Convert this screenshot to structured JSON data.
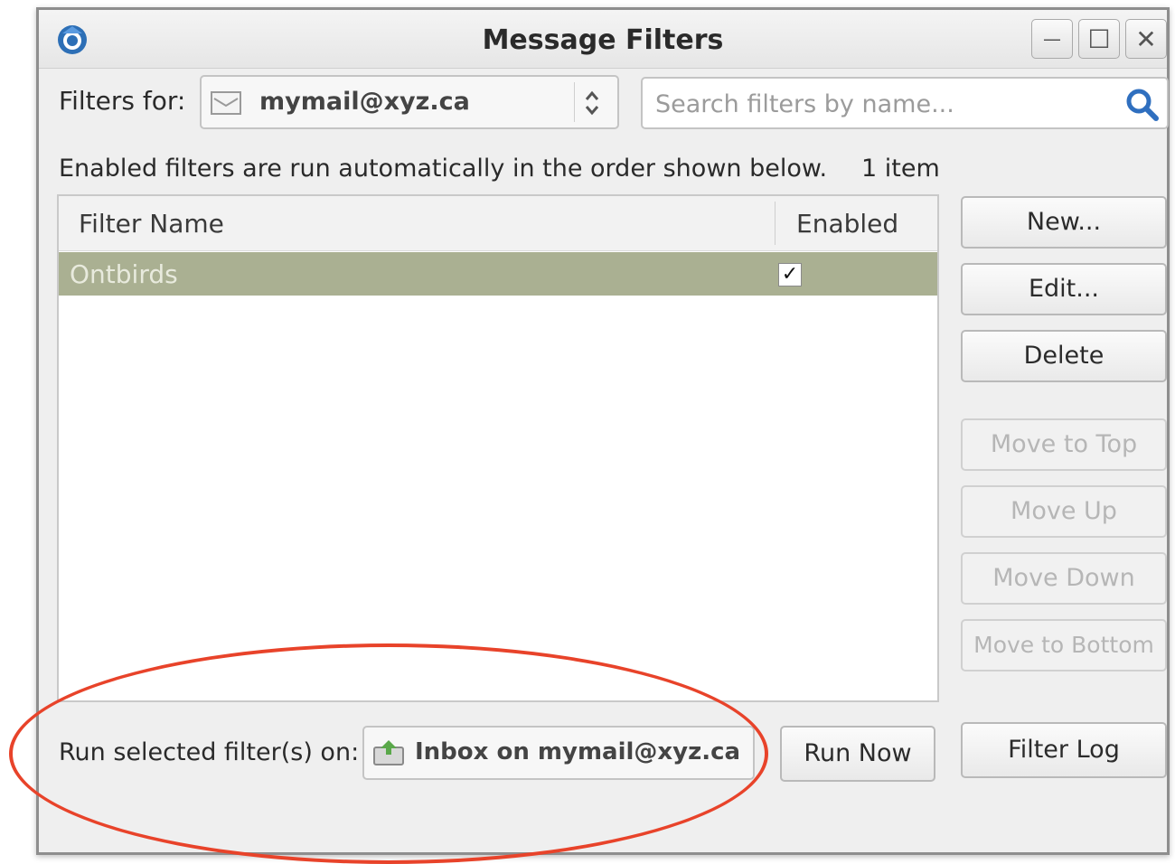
{
  "window": {
    "title": "Message Filters",
    "app_icon": "thunderbird-icon",
    "controls": {
      "minimize": "—",
      "maximize": "☐",
      "close": "✕"
    }
  },
  "filters_for": {
    "label": "Filters for:",
    "account": "mymail@xyz.ca"
  },
  "search": {
    "placeholder": "Search filters by name...",
    "value": ""
  },
  "info": {
    "description": "Enabled filters are run automatically in the order shown below.",
    "count": "1 item"
  },
  "list": {
    "columns": [
      "Filter Name",
      "Enabled"
    ],
    "rows": [
      {
        "name": "Ontbirds",
        "enabled": true,
        "selected": true
      }
    ]
  },
  "buttons": {
    "new": "New...",
    "edit": "Edit...",
    "delete": "Delete",
    "move_top": "Move to Top",
    "move_up": "Move Up",
    "move_down": "Move Down",
    "move_bottom": "Move to Bottom",
    "filter_log": "Filter Log",
    "run_now": "Run Now"
  },
  "run": {
    "label": "Run selected filter(s) on:",
    "folder": "Inbox on mymail@xyz.ca"
  },
  "colors": {
    "selected_row": "#aab092",
    "annotation": "#e8432a"
  }
}
